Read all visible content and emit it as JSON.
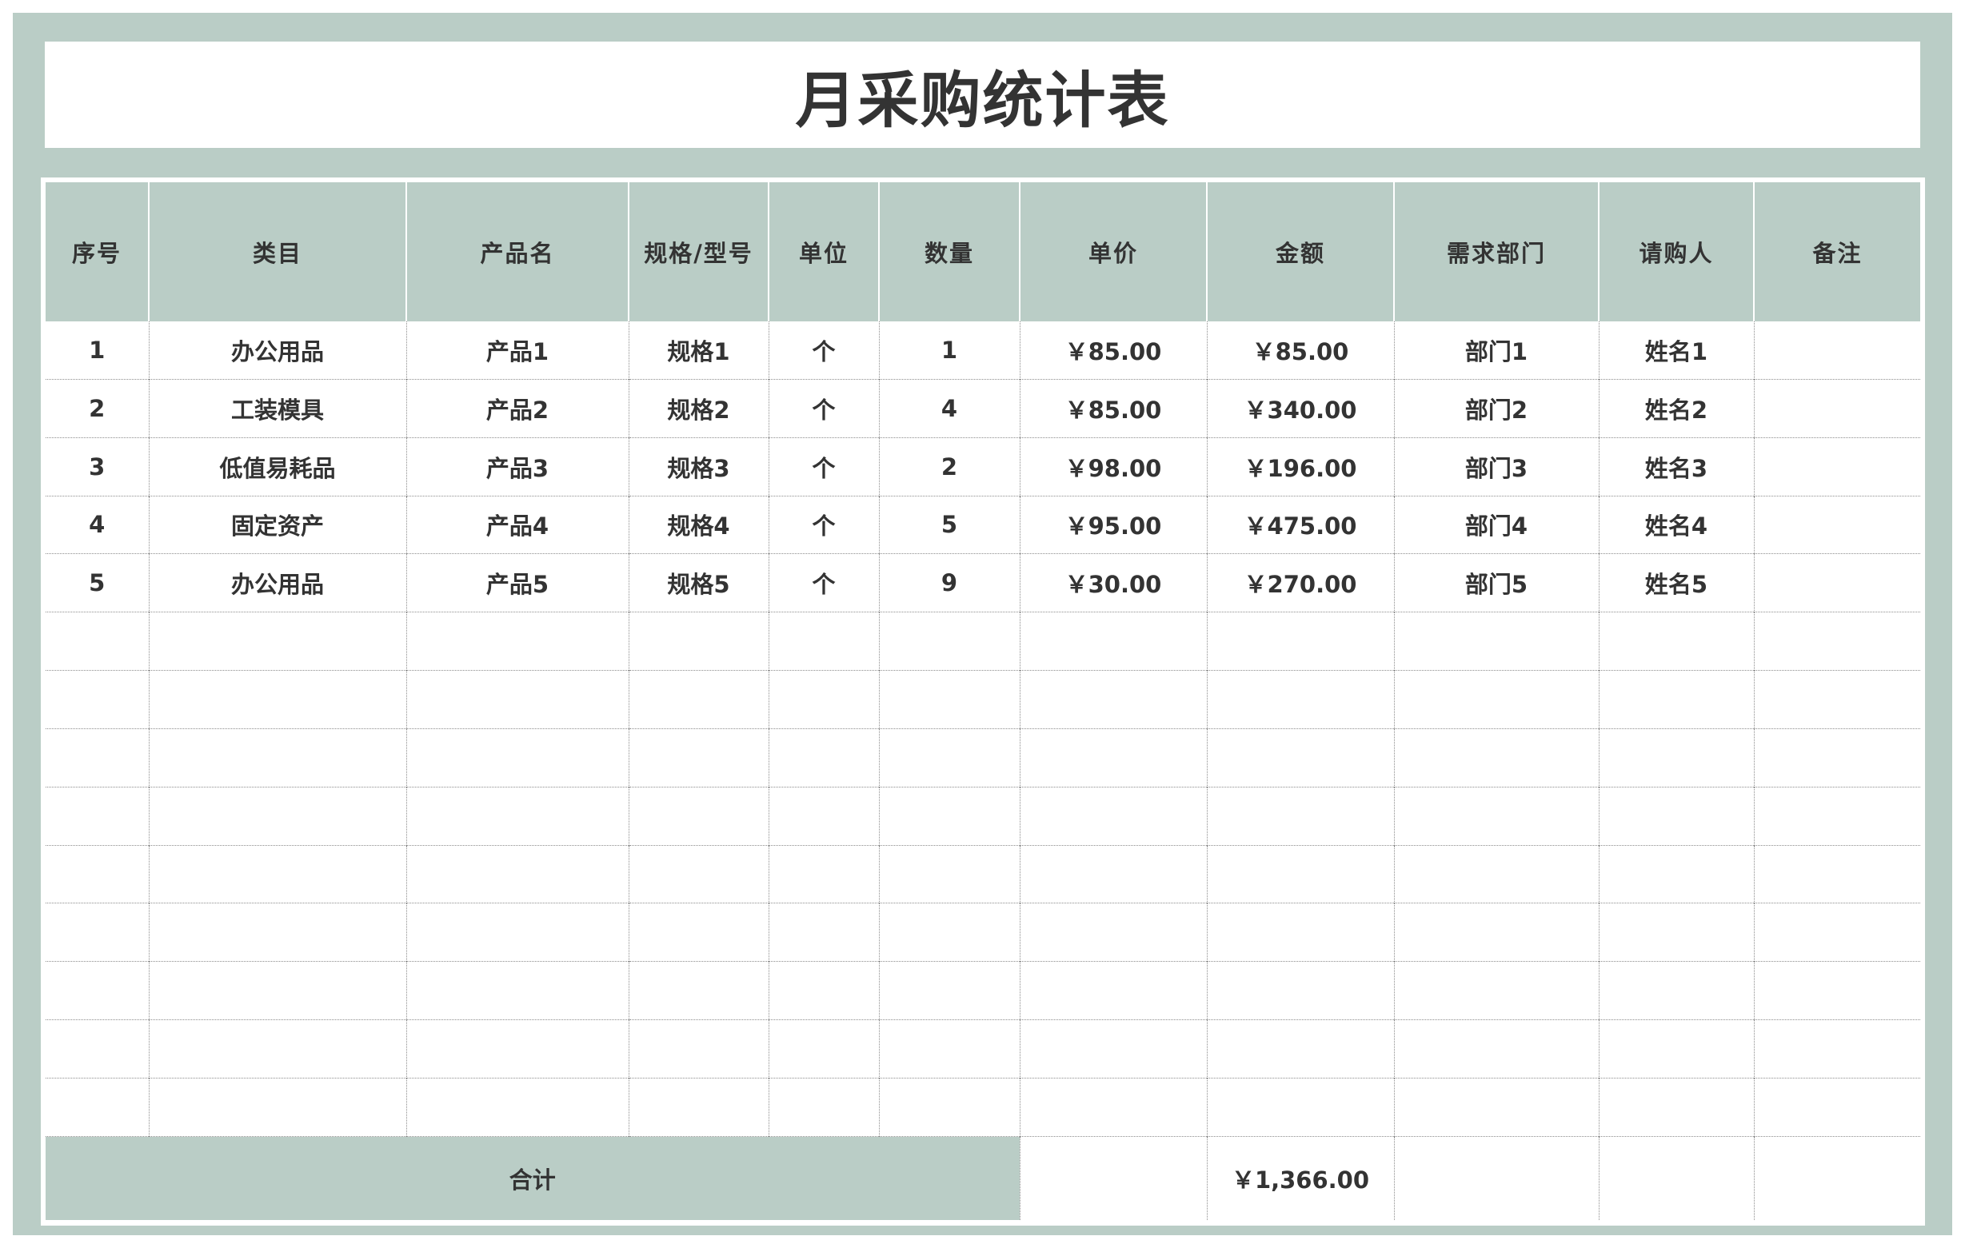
{
  "title": "月采购统计表",
  "headers": [
    "序号",
    "类目",
    "产品名",
    "规格/型号",
    "单位",
    "数量",
    "单价",
    "金额",
    "需求部门",
    "请购人",
    "备注"
  ],
  "rows": [
    [
      "1",
      "办公用品",
      "产品1",
      "规格1",
      "个",
      "1",
      "￥85.00",
      "￥85.00",
      "部门1",
      "姓名1",
      ""
    ],
    [
      "2",
      "工装模具",
      "产品2",
      "规格2",
      "个",
      "4",
      "￥85.00",
      "￥340.00",
      "部门2",
      "姓名2",
      ""
    ],
    [
      "3",
      "低值易耗品",
      "产品3",
      "规格3",
      "个",
      "2",
      "￥98.00",
      "￥196.00",
      "部门3",
      "姓名3",
      ""
    ],
    [
      "4",
      "固定资产",
      "产品4",
      "规格4",
      "个",
      "5",
      "￥95.00",
      "￥475.00",
      "部门4",
      "姓名4",
      ""
    ],
    [
      "5",
      "办公用品",
      "产品5",
      "规格5",
      "个",
      "9",
      "￥30.00",
      "￥270.00",
      "部门5",
      "姓名5",
      ""
    ],
    [
      "",
      "",
      "",
      "",
      "",
      "",
      "",
      "",
      "",
      "",
      ""
    ],
    [
      "",
      "",
      "",
      "",
      "",
      "",
      "",
      "",
      "",
      "",
      ""
    ],
    [
      "",
      "",
      "",
      "",
      "",
      "",
      "",
      "",
      "",
      "",
      ""
    ],
    [
      "",
      "",
      "",
      "",
      "",
      "",
      "",
      "",
      "",
      "",
      ""
    ],
    [
      "",
      "",
      "",
      "",
      "",
      "",
      "",
      "",
      "",
      "",
      ""
    ],
    [
      "",
      "",
      "",
      "",
      "",
      "",
      "",
      "",
      "",
      "",
      ""
    ],
    [
      "",
      "",
      "",
      "",
      "",
      "",
      "",
      "",
      "",
      "",
      ""
    ],
    [
      "",
      "",
      "",
      "",
      "",
      "",
      "",
      "",
      "",
      "",
      ""
    ],
    [
      "",
      "",
      "",
      "",
      "",
      "",
      "",
      "",
      "",
      "",
      ""
    ]
  ],
  "footer": {
    "label": "合计",
    "unit_price_total": "",
    "amount_total": "￥1,366.00",
    "department": "",
    "requester": "",
    "note": ""
  },
  "colors": {
    "accent": "#bacdc6",
    "text": "#333333",
    "grid": "#8c8c8c"
  }
}
